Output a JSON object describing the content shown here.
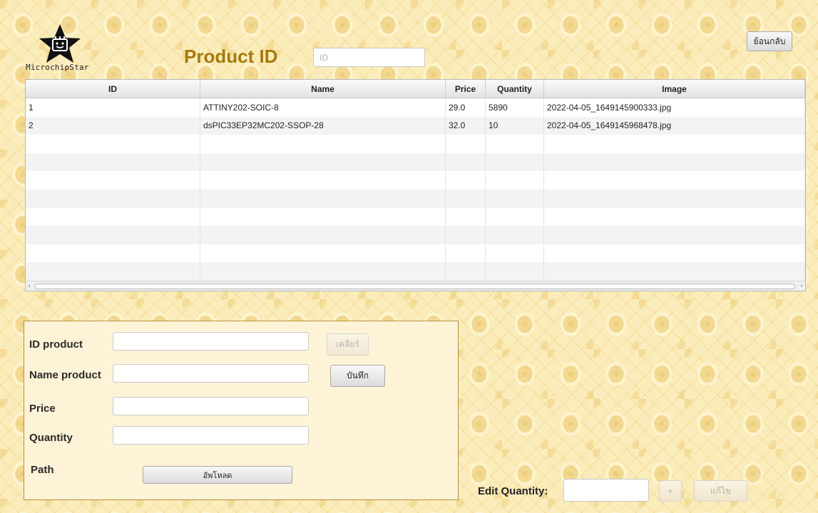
{
  "brand": {
    "logo_text": "MicrochipStar"
  },
  "header": {
    "title": "Product ID",
    "search_placeholder": "ID",
    "back_label": "ย้อนกลับ"
  },
  "table": {
    "columns": [
      "ID",
      "Name",
      "Price",
      "Quantity",
      "Image"
    ],
    "rows": [
      [
        "1",
        "ATTINY202-SOIC-8",
        "29.0",
        "5890",
        "2022-04-05_1649145900333.jpg"
      ],
      [
        "2",
        "dsPIC33EP32MC202-SSOP-28",
        "32.0",
        "10",
        "2022-04-05_1649145968478.jpg"
      ]
    ],
    "empty_rows": 8
  },
  "form": {
    "id_label": "ID product",
    "name_label": "Name product",
    "price_label": "Price",
    "quantity_label": "Quantity",
    "path_label": "Path",
    "clear_label": "เคลียร์",
    "save_label": "บันทึก",
    "upload_label": "อัพโหลด"
  },
  "edit": {
    "label": "Edit Quantity:",
    "plus_label": "+",
    "edit_label": "แก้ไข"
  }
}
